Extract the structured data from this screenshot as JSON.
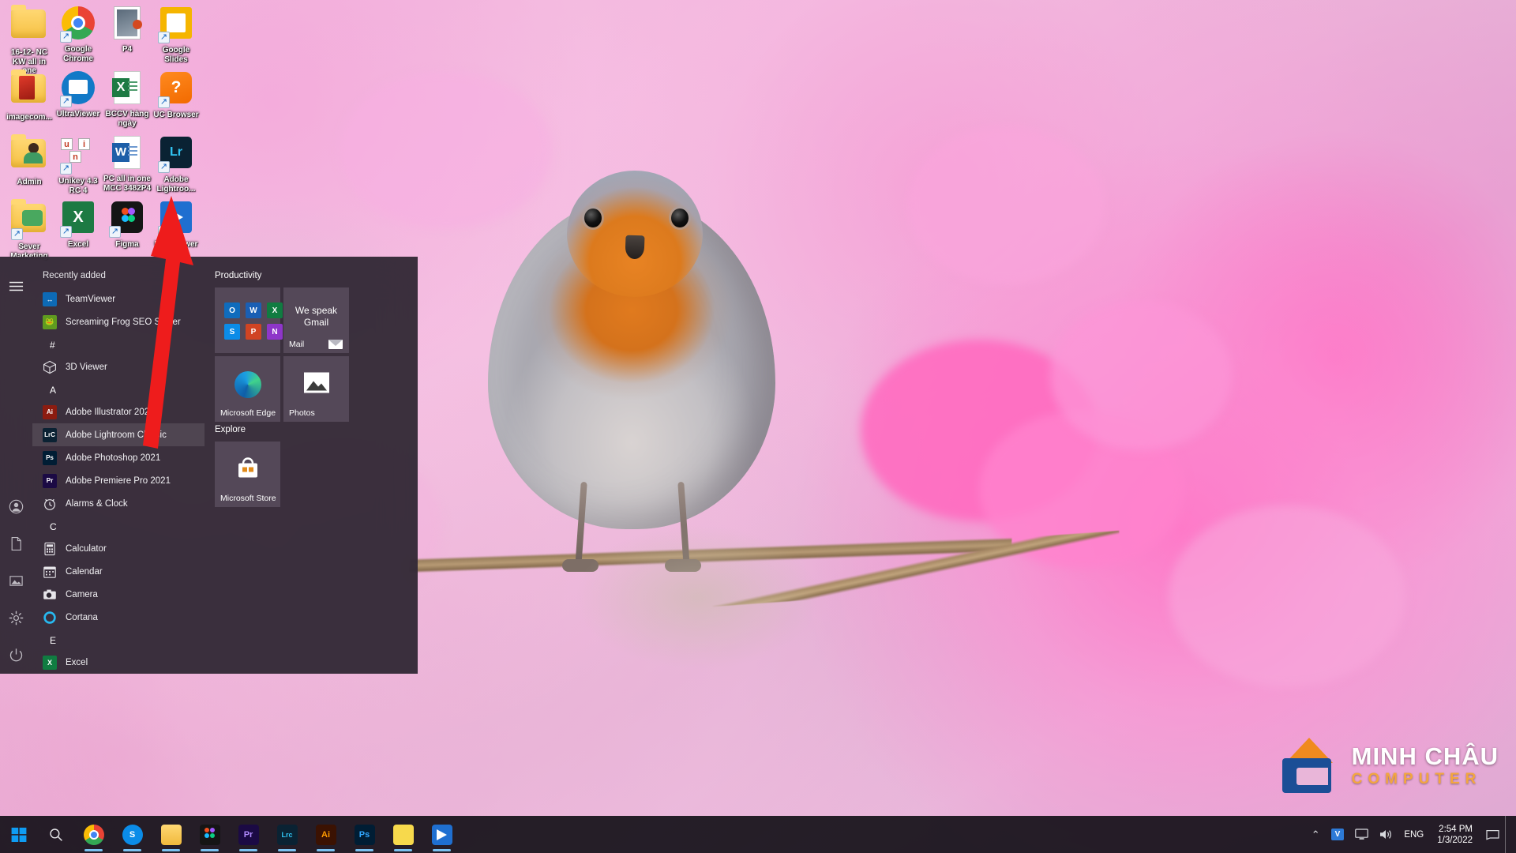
{
  "desktop": {
    "icons": [
      {
        "label": "16-12- NC KW all in one",
        "type": "folder",
        "shortcut": false,
        "col": 0,
        "row": 0
      },
      {
        "label": "Google Chrome",
        "type": "chrome",
        "shortcut": true,
        "col": 1,
        "row": 0
      },
      {
        "label": "P4",
        "type": "image-file",
        "shortcut": false,
        "col": 2,
        "row": 0
      },
      {
        "label": "Google Slides",
        "type": "slides",
        "shortcut": true,
        "col": 3,
        "row": 0
      },
      {
        "label": "imagecom...",
        "type": "folder-red",
        "shortcut": false,
        "col": 0,
        "row": 1
      },
      {
        "label": "UltraViewer",
        "type": "ultraviewer",
        "shortcut": true,
        "col": 1,
        "row": 1
      },
      {
        "label": "BCCV hàng ngày",
        "type": "excel-doc",
        "shortcut": false,
        "col": 2,
        "row": 1
      },
      {
        "label": "UC Browser",
        "type": "ucbrowser",
        "shortcut": true,
        "col": 3,
        "row": 1
      },
      {
        "label": "Admin",
        "type": "folder-user",
        "shortcut": false,
        "col": 0,
        "row": 2
      },
      {
        "label": "Unikey 4.3 RC 4",
        "type": "unikey",
        "shortcut": true,
        "col": 1,
        "row": 2
      },
      {
        "label": "PC all in one MCC 3482P4",
        "type": "word-doc",
        "shortcut": false,
        "col": 2,
        "row": 2
      },
      {
        "label": "Adobe Lightroo...",
        "type": "lightroom",
        "shortcut": true,
        "col": 3,
        "row": 2
      },
      {
        "label": "Sever Marketing",
        "type": "folder-green",
        "shortcut": true,
        "col": 0,
        "row": 3
      },
      {
        "label": "Excel",
        "type": "excel",
        "shortcut": true,
        "col": 1,
        "row": 3
      },
      {
        "label": "Figma",
        "type": "figma",
        "shortcut": true,
        "col": 2,
        "row": 3
      },
      {
        "label": "UltraViewer",
        "type": "ultraviewer-blue",
        "shortcut": true,
        "col": 3,
        "row": 3
      }
    ]
  },
  "start_menu": {
    "rail": {
      "hamburger_label": "Menu",
      "items": [
        "hamburger-icon",
        "account-icon",
        "documents-icon",
        "pictures-icon",
        "settings-icon",
        "power-icon"
      ]
    },
    "recently_added_label": "Recently added",
    "recently_added": [
      {
        "label": "TeamViewer",
        "icon": "teamviewer-icon",
        "color": "#0d6ab5"
      },
      {
        "label": "Screaming Frog SEO Spider",
        "icon": "screamingfrog-icon",
        "color": "#5f9b20"
      }
    ],
    "sections": [
      {
        "letter": "#",
        "apps": [
          {
            "label": "3D Viewer",
            "icon": "cube-icon",
            "color": "transparent",
            "selected": false
          }
        ]
      },
      {
        "letter": "A",
        "apps": [
          {
            "label": "Adobe Illustrator 2021",
            "icon": "Ai",
            "color": "#8c1c10",
            "selected": false
          },
          {
            "label": "Adobe Lightroom Classic",
            "icon": "LrC",
            "color": "#0b2233",
            "selected": true
          },
          {
            "label": "Adobe Photoshop 2021",
            "icon": "Ps",
            "color": "#001d34",
            "selected": false
          },
          {
            "label": "Adobe Premiere Pro 2021",
            "icon": "Pr",
            "color": "#1b0a44",
            "selected": false
          },
          {
            "label": "Alarms & Clock",
            "icon": "alarm-icon",
            "color": "transparent",
            "selected": false
          }
        ]
      },
      {
        "letter": "C",
        "apps": [
          {
            "label": "Calculator",
            "icon": "calculator-icon",
            "color": "transparent",
            "selected": false
          },
          {
            "label": "Calendar",
            "icon": "calendar-icon",
            "color": "transparent",
            "selected": false
          },
          {
            "label": "Camera",
            "icon": "camera-icon",
            "color": "transparent",
            "selected": false
          },
          {
            "label": "Cortana",
            "icon": "cortana-icon",
            "color": "transparent",
            "selected": false
          }
        ]
      },
      {
        "letter": "E",
        "apps": [
          {
            "label": "Excel",
            "icon": "excel-icon",
            "color": "#107c41",
            "selected": false
          }
        ]
      }
    ],
    "tile_groups": [
      {
        "title": "Productivity",
        "rows": [
          [
            {
              "name": "",
              "kind": "office-grid",
              "cells": [
                {
                  "glyph": "O",
                  "color": "#0f6cbd"
                },
                {
                  "glyph": "W",
                  "color": "#1a5fb4"
                },
                {
                  "glyph": "X",
                  "color": "#107c41"
                },
                {
                  "glyph": "S",
                  "color": "#0b8ce8"
                },
                {
                  "glyph": "P",
                  "color": "#d04423"
                },
                {
                  "glyph": "N",
                  "color": "#8e36c9"
                }
              ]
            },
            {
              "name": "Mail",
              "kind": "mail",
              "headline": "We speak Gmail"
            }
          ],
          [
            {
              "name": "Microsoft Edge",
              "kind": "edge"
            },
            {
              "name": "Photos",
              "kind": "photos"
            }
          ]
        ]
      },
      {
        "title": "Explore",
        "rows": [
          [
            {
              "name": "Microsoft Store",
              "kind": "store"
            }
          ]
        ]
      }
    ]
  },
  "taskbar": {
    "start_label": "Start",
    "search_label": "Search",
    "apps": [
      {
        "name": "Google Chrome",
        "icon": "chrome-icon",
        "running": true
      },
      {
        "name": "Skype",
        "icon": "skype-icon",
        "running": true
      },
      {
        "name": "File Explorer",
        "icon": "folder-icon",
        "running": true
      },
      {
        "name": "Figma",
        "icon": "figma-icon",
        "running": true
      },
      {
        "name": "Adobe Premiere Pro",
        "icon": "Pr",
        "running": true
      },
      {
        "name": "Adobe Lightroom Classic",
        "icon": "Lrc",
        "running": true
      },
      {
        "name": "Adobe Illustrator",
        "icon": "Ai",
        "running": true
      },
      {
        "name": "Adobe Photoshop",
        "icon": "Ps",
        "running": true
      },
      {
        "name": "Sticky Notes",
        "icon": "notes-icon",
        "running": true
      },
      {
        "name": "UltraViewer",
        "icon": "ultraviewer-icon",
        "running": true
      }
    ],
    "tray": {
      "chevron": "⌃",
      "items": [
        {
          "name": "unikey-indicator",
          "glyph": "V",
          "color": "#2d7ad6"
        },
        {
          "name": "display-icon",
          "glyph": "▭",
          "color": "#cfd6e0"
        },
        {
          "name": "volume-icon",
          "glyph": "🔊",
          "color": "#cfd6e0"
        },
        {
          "name": "language-indicator",
          "glyph": "ENG",
          "color": "#ffffff"
        }
      ],
      "language": "ENG",
      "time": "2:54 PM",
      "date": "1/3/2022",
      "notification_label": "Notifications"
    }
  },
  "watermark": {
    "line1": "MINH CHÂU",
    "line2": "COMPUTER"
  },
  "annotation": {
    "arrow_color": "#ee1c1c",
    "points_to": "Adobe Lightroom Classic"
  },
  "colors": {
    "start_menu_bg": "#2c2530",
    "taskbar_bg": "#141018",
    "accent": "#0078d7",
    "arrow": "#ee1c1c"
  }
}
